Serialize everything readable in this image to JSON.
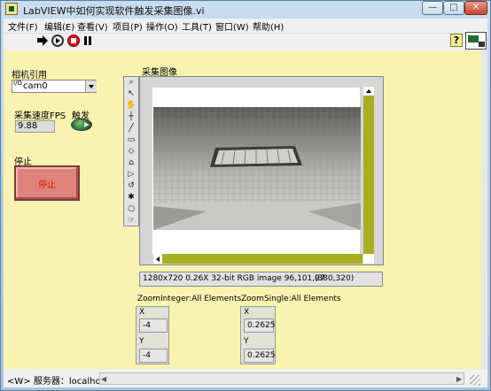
{
  "window": {
    "title": "LabVIEW中如何实现软件触发采集图像.vi",
    "min_glyph": "—",
    "max_glyph": "□",
    "close_glyph": "✕"
  },
  "menu": [
    "文件(F)",
    "编辑(E)",
    "查看(V)",
    "项目(P)",
    "操作(O)",
    "工具(T)",
    "窗口(W)",
    "帮助(H)"
  ],
  "toolbar": {
    "help_label": "?"
  },
  "camera": {
    "label": "相机引用",
    "value": "cam0",
    "io_glyph": "I/O"
  },
  "fps": {
    "label": "采集速度FPS",
    "value": "9.88"
  },
  "trigger": {
    "label": "触发",
    "state": "on"
  },
  "stop": {
    "caption": "停止",
    "button_label": "停止"
  },
  "image_display": {
    "label": "采集图像",
    "info": "1280x720 0.26X 32-bit RGB image 96,101,97",
    "coords": "(380,320)",
    "tools": [
      "⌕",
      "↖",
      "✋",
      "┼",
      "╱",
      "▭",
      "◇",
      "⌂",
      "▷",
      "↺",
      "✱",
      "○",
      "☞"
    ]
  },
  "zoom_integer": {
    "label": "ZoomInteger:All Elements",
    "x_label": "X",
    "x_value": "-4",
    "y_label": "Y",
    "y_value": "-4"
  },
  "zoom_single": {
    "label": "ZoomSingle:All Elements",
    "x_label": "X",
    "x_value": "0.2625",
    "y_label": "Y",
    "y_value": "0.2625"
  },
  "status": {
    "text": "<W> 服务器：localhost"
  },
  "colors": {
    "panel": "#f8f3b0",
    "scroll_accent": "#a9ad1e",
    "stop_button": "#e0827c",
    "stop_text": "#d81515",
    "led_on": "#1e5a22"
  }
}
